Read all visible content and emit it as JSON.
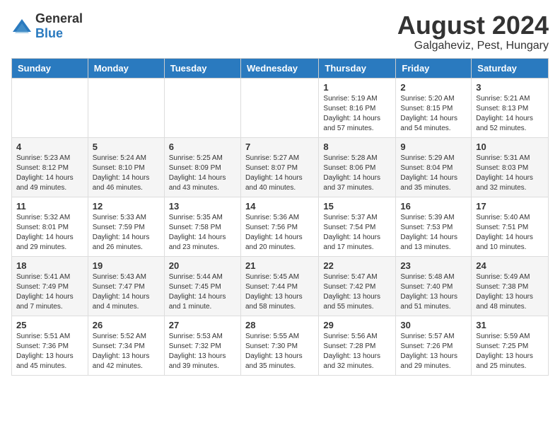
{
  "logo": {
    "general": "General",
    "blue": "Blue"
  },
  "title": {
    "month_year": "August 2024",
    "location": "Galgaheviz, Pest, Hungary"
  },
  "weekdays": [
    "Sunday",
    "Monday",
    "Tuesday",
    "Wednesday",
    "Thursday",
    "Friday",
    "Saturday"
  ],
  "weeks": [
    [
      {
        "day": "",
        "info": ""
      },
      {
        "day": "",
        "info": ""
      },
      {
        "day": "",
        "info": ""
      },
      {
        "day": "",
        "info": ""
      },
      {
        "day": "1",
        "info": "Sunrise: 5:19 AM\nSunset: 8:16 PM\nDaylight: 14 hours\nand 57 minutes."
      },
      {
        "day": "2",
        "info": "Sunrise: 5:20 AM\nSunset: 8:15 PM\nDaylight: 14 hours\nand 54 minutes."
      },
      {
        "day": "3",
        "info": "Sunrise: 5:21 AM\nSunset: 8:13 PM\nDaylight: 14 hours\nand 52 minutes."
      }
    ],
    [
      {
        "day": "4",
        "info": "Sunrise: 5:23 AM\nSunset: 8:12 PM\nDaylight: 14 hours\nand 49 minutes."
      },
      {
        "day": "5",
        "info": "Sunrise: 5:24 AM\nSunset: 8:10 PM\nDaylight: 14 hours\nand 46 minutes."
      },
      {
        "day": "6",
        "info": "Sunrise: 5:25 AM\nSunset: 8:09 PM\nDaylight: 14 hours\nand 43 minutes."
      },
      {
        "day": "7",
        "info": "Sunrise: 5:27 AM\nSunset: 8:07 PM\nDaylight: 14 hours\nand 40 minutes."
      },
      {
        "day": "8",
        "info": "Sunrise: 5:28 AM\nSunset: 8:06 PM\nDaylight: 14 hours\nand 37 minutes."
      },
      {
        "day": "9",
        "info": "Sunrise: 5:29 AM\nSunset: 8:04 PM\nDaylight: 14 hours\nand 35 minutes."
      },
      {
        "day": "10",
        "info": "Sunrise: 5:31 AM\nSunset: 8:03 PM\nDaylight: 14 hours\nand 32 minutes."
      }
    ],
    [
      {
        "day": "11",
        "info": "Sunrise: 5:32 AM\nSunset: 8:01 PM\nDaylight: 14 hours\nand 29 minutes."
      },
      {
        "day": "12",
        "info": "Sunrise: 5:33 AM\nSunset: 7:59 PM\nDaylight: 14 hours\nand 26 minutes."
      },
      {
        "day": "13",
        "info": "Sunrise: 5:35 AM\nSunset: 7:58 PM\nDaylight: 14 hours\nand 23 minutes."
      },
      {
        "day": "14",
        "info": "Sunrise: 5:36 AM\nSunset: 7:56 PM\nDaylight: 14 hours\nand 20 minutes."
      },
      {
        "day": "15",
        "info": "Sunrise: 5:37 AM\nSunset: 7:54 PM\nDaylight: 14 hours\nand 17 minutes."
      },
      {
        "day": "16",
        "info": "Sunrise: 5:39 AM\nSunset: 7:53 PM\nDaylight: 14 hours\nand 13 minutes."
      },
      {
        "day": "17",
        "info": "Sunrise: 5:40 AM\nSunset: 7:51 PM\nDaylight: 14 hours\nand 10 minutes."
      }
    ],
    [
      {
        "day": "18",
        "info": "Sunrise: 5:41 AM\nSunset: 7:49 PM\nDaylight: 14 hours\nand 7 minutes."
      },
      {
        "day": "19",
        "info": "Sunrise: 5:43 AM\nSunset: 7:47 PM\nDaylight: 14 hours\nand 4 minutes."
      },
      {
        "day": "20",
        "info": "Sunrise: 5:44 AM\nSunset: 7:45 PM\nDaylight: 14 hours\nand 1 minute."
      },
      {
        "day": "21",
        "info": "Sunrise: 5:45 AM\nSunset: 7:44 PM\nDaylight: 13 hours\nand 58 minutes."
      },
      {
        "day": "22",
        "info": "Sunrise: 5:47 AM\nSunset: 7:42 PM\nDaylight: 13 hours\nand 55 minutes."
      },
      {
        "day": "23",
        "info": "Sunrise: 5:48 AM\nSunset: 7:40 PM\nDaylight: 13 hours\nand 51 minutes."
      },
      {
        "day": "24",
        "info": "Sunrise: 5:49 AM\nSunset: 7:38 PM\nDaylight: 13 hours\nand 48 minutes."
      }
    ],
    [
      {
        "day": "25",
        "info": "Sunrise: 5:51 AM\nSunset: 7:36 PM\nDaylight: 13 hours\nand 45 minutes."
      },
      {
        "day": "26",
        "info": "Sunrise: 5:52 AM\nSunset: 7:34 PM\nDaylight: 13 hours\nand 42 minutes."
      },
      {
        "day": "27",
        "info": "Sunrise: 5:53 AM\nSunset: 7:32 PM\nDaylight: 13 hours\nand 39 minutes."
      },
      {
        "day": "28",
        "info": "Sunrise: 5:55 AM\nSunset: 7:30 PM\nDaylight: 13 hours\nand 35 minutes."
      },
      {
        "day": "29",
        "info": "Sunrise: 5:56 AM\nSunset: 7:28 PM\nDaylight: 13 hours\nand 32 minutes."
      },
      {
        "day": "30",
        "info": "Sunrise: 5:57 AM\nSunset: 7:26 PM\nDaylight: 13 hours\nand 29 minutes."
      },
      {
        "day": "31",
        "info": "Sunrise: 5:59 AM\nSunset: 7:25 PM\nDaylight: 13 hours\nand 25 minutes."
      }
    ]
  ]
}
